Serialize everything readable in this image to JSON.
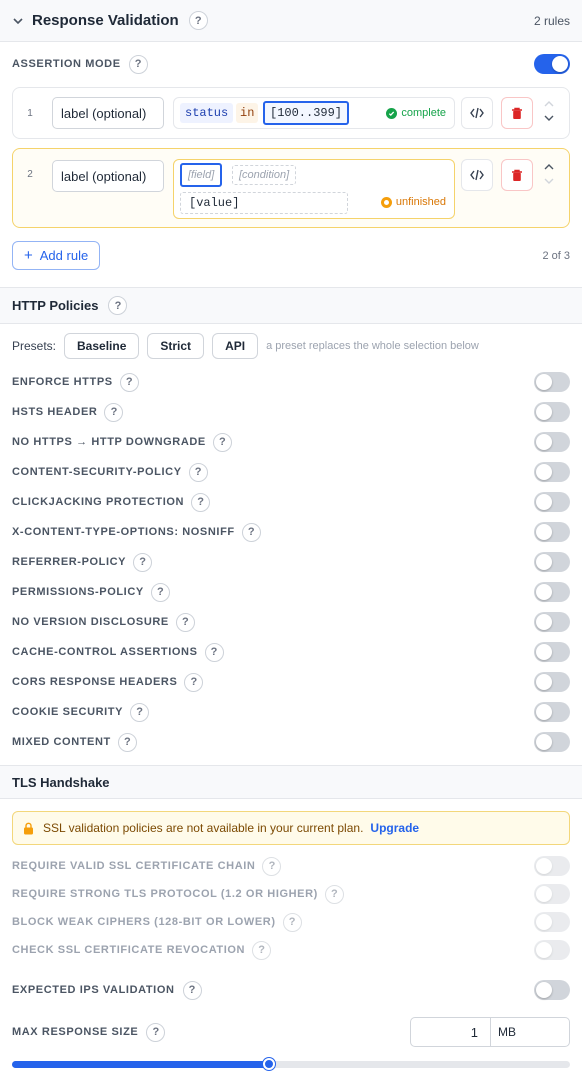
{
  "response_validation": {
    "title": "Response Validation",
    "rule_count": "2 rules",
    "assertion_mode_label": "ASSERTION MODE",
    "assertion_mode_on": true,
    "rules": [
      {
        "index": "1",
        "label_placeholder": "label (optional)",
        "field": "status",
        "op": "in",
        "value": "[100..399]",
        "state": "complete"
      },
      {
        "index": "2",
        "label_placeholder": "label (optional)",
        "field_placeholder": "[field]",
        "condition_placeholder": "[condition]",
        "value_placeholder": "[value]",
        "state": "unfinished"
      }
    ],
    "add_rule_label": "Add rule",
    "rule_limit": "2 of 3"
  },
  "http_policies": {
    "title": "HTTP Policies",
    "presets_label": "Presets:",
    "presets": [
      "Baseline",
      "Strict",
      "API"
    ],
    "presets_hint": "a preset replaces the whole selection below",
    "policies": [
      {
        "label": "ENFORCE HTTPS",
        "on": false
      },
      {
        "label": "HSTS HEADER",
        "on": false
      },
      {
        "label": "NO HTTPS → HTTP DOWNGRADE",
        "on": false
      },
      {
        "label": "CONTENT-SECURITY-POLICY",
        "on": false
      },
      {
        "label": "CLICKJACKING PROTECTION",
        "on": false
      },
      {
        "label": "X-CONTENT-TYPE-OPTIONS: NOSNIFF",
        "on": false
      },
      {
        "label": "REFERRER-POLICY",
        "on": false
      },
      {
        "label": "PERMISSIONS-POLICY",
        "on": false
      },
      {
        "label": "NO VERSION DISCLOSURE",
        "on": false
      },
      {
        "label": "CACHE-CONTROL ASSERTIONS",
        "on": false
      },
      {
        "label": "CORS RESPONSE HEADERS",
        "on": false
      },
      {
        "label": "COOKIE SECURITY",
        "on": false
      },
      {
        "label": "MIXED CONTENT",
        "on": false
      }
    ]
  },
  "tls": {
    "title": "TLS Handshake",
    "notice": "SSL validation policies are not available in your current plan.",
    "upgrade_label": "Upgrade",
    "locked": [
      {
        "label": "REQUIRE VALID SSL CERTIFICATE CHAIN"
      },
      {
        "label": "REQUIRE STRONG TLS PROTOCOL (1.2 OR HIGHER)"
      },
      {
        "label": "BLOCK WEAK CIPHERS (128-BIT OR LOWER)"
      },
      {
        "label": "CHECK SSL CERTIFICATE REVOCATION"
      }
    ],
    "expected_ips_label": "EXPECTED IPS VALIDATION",
    "expected_ips_on": false,
    "max_size_label": "MAX RESPONSE SIZE",
    "max_size_value": "1",
    "max_size_unit": "MB",
    "slider_fraction": 0.46
  },
  "colors": {
    "accent": "#2563eb",
    "complete": "#16a34a",
    "unfinished": "#f59e0b",
    "danger": "#dc2626"
  },
  "icons": [
    "chevron-down-icon",
    "help-icon",
    "code-icon",
    "trash-icon",
    "chevron-up-icon",
    "plus-icon",
    "lock-icon",
    "check-circle-icon"
  ]
}
